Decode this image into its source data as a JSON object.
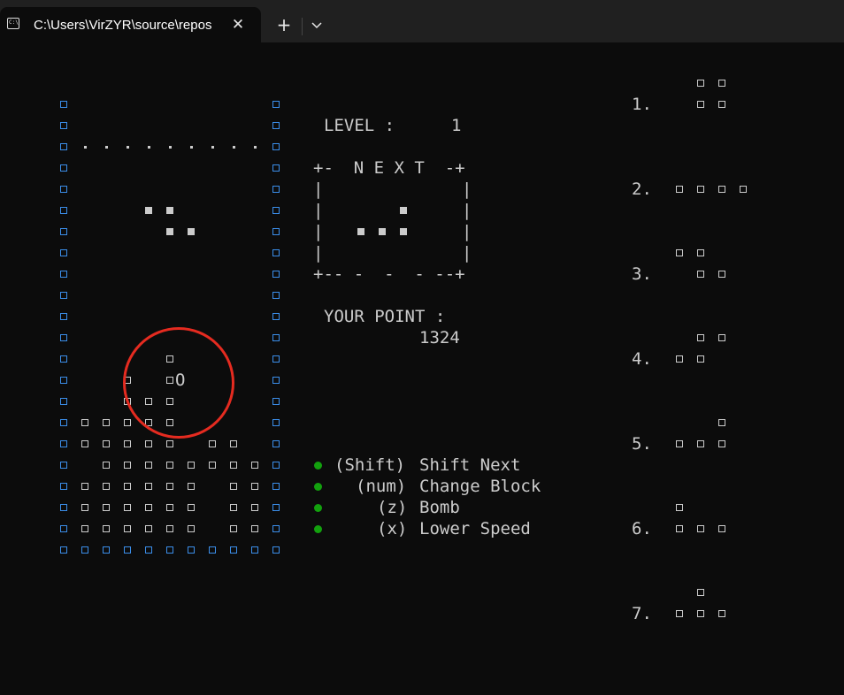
{
  "window": {
    "tab_title": "C:\\Users\\VirZYR\\source\\repos",
    "tab_icon": "terminal-icon",
    "close_glyph": "✕",
    "new_tab_glyph": "+"
  },
  "game": {
    "level_label": "LEVEL :",
    "level_value": "1",
    "next_header": "+-  N E X T  -+",
    "next_side": "|",
    "next_footer": "+-- -  -  - --+",
    "points_label": "YOUR POINT :",
    "points_value": "1324",
    "cursor_char": "O",
    "controls": [
      {
        "key": "(Shift)",
        "action": "Shift Next"
      },
      {
        "key": "(num)",
        "action": "Change Block"
      },
      {
        "key": "(z)",
        "action": "Bomb"
      },
      {
        "key": "(x)",
        "action": "Lower Speed"
      }
    ],
    "block_list": [
      {
        "number": "1."
      },
      {
        "number": "2."
      },
      {
        "number": "3."
      },
      {
        "number": "4."
      },
      {
        "number": "5."
      },
      {
        "number": "6."
      },
      {
        "number": "7."
      }
    ]
  },
  "colors": {
    "background": "#0c0c0c",
    "text": "#cccccc",
    "wall": "#3b8eea",
    "bullet": "#13a10e",
    "highlight": "#e52b20"
  }
}
